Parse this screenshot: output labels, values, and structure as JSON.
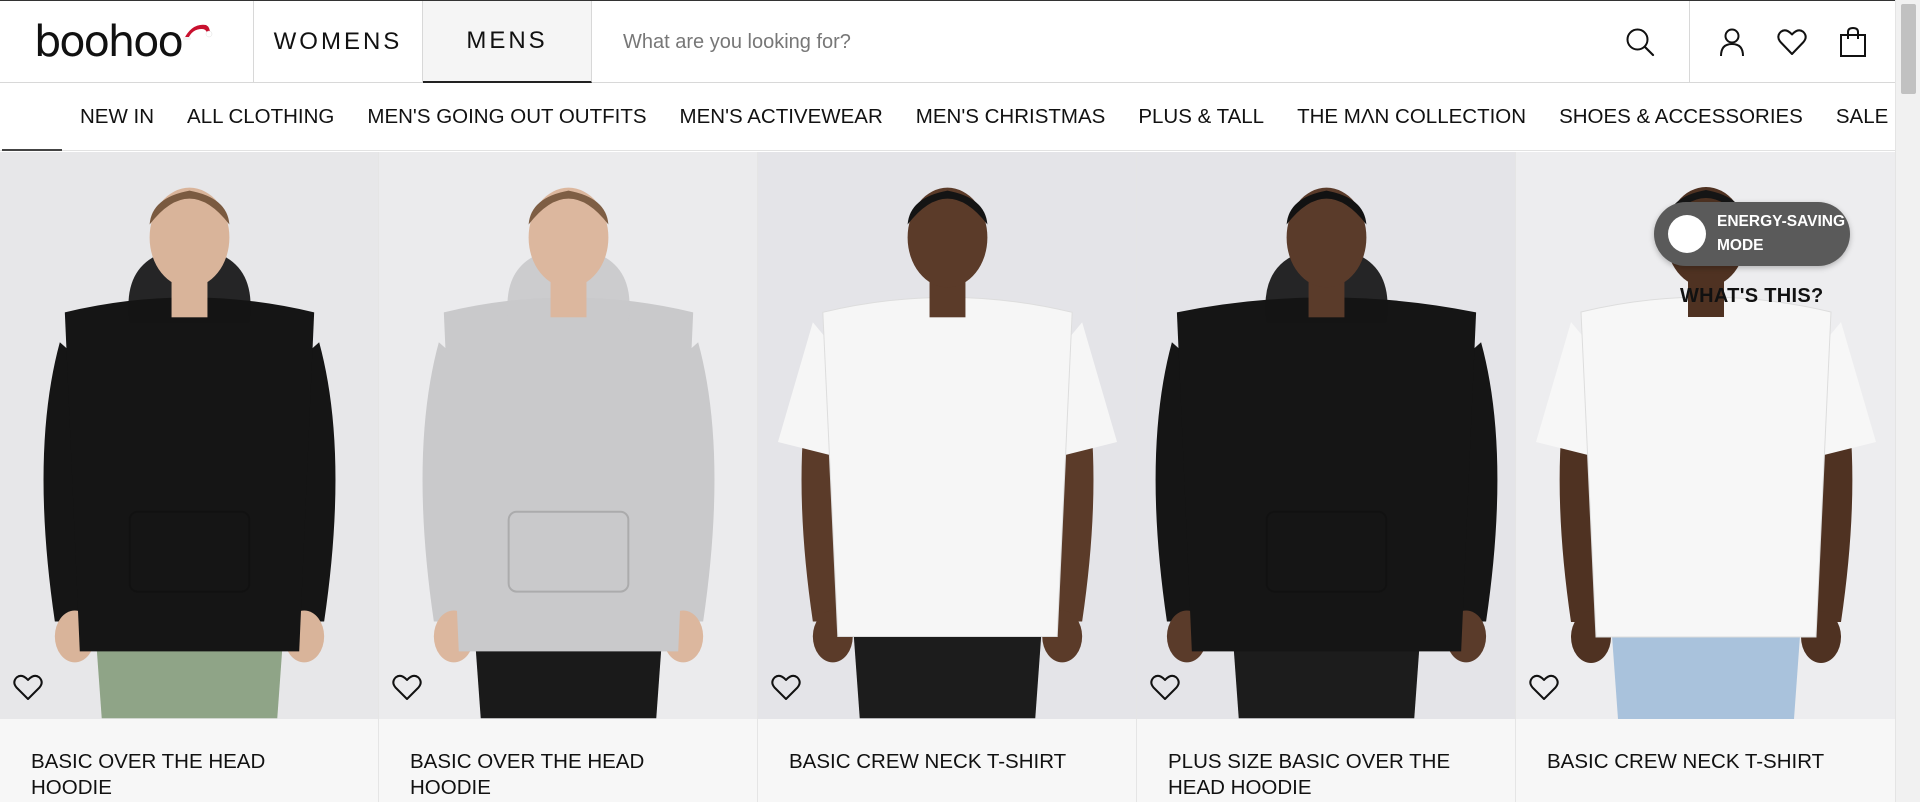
{
  "header": {
    "logo_text": "boohoo",
    "gender_tabs": [
      {
        "label": "WOMENS",
        "active": false
      },
      {
        "label": "MENS",
        "active": true
      }
    ],
    "search": {
      "placeholder": "What are you looking for?",
      "icon": "search-icon"
    },
    "icons": [
      "account-icon",
      "wishlist-icon",
      "bag-icon"
    ]
  },
  "nav": {
    "items": [
      {
        "label": "NEW IN"
      },
      {
        "label": "ALL CLOTHING"
      },
      {
        "label": "MEN'S GOING OUT OUTFITS"
      },
      {
        "label": "MEN'S ACTIVEWEAR"
      },
      {
        "label": "MEN'S CHRISTMAS"
      },
      {
        "label": "PLUS & TALL"
      },
      {
        "label": "THE MΛN COLLECTION"
      },
      {
        "label": "SHOES & ACCESSORIES"
      },
      {
        "label": "SALE"
      }
    ]
  },
  "products": [
    {
      "title": "BASIC OVER THE HEAD HOODIE",
      "top_color": "#151515",
      "bottom_color": "#8fa487",
      "skin": "#d9b49a",
      "hair": "#7a5a40",
      "bg": "#e7e7e9"
    },
    {
      "title": "BASIC OVER THE HEAD HOODIE",
      "top_color": "#c9c9cb",
      "bottom_color": "#1a1a1a",
      "skin": "#dcb79e",
      "hair": "#7e5e44",
      "bg": "#ebebed"
    },
    {
      "title": "BASIC CREW NECK T-SHIRT",
      "top_color": "#f6f6f6",
      "bottom_color": "#1c1c1c",
      "skin": "#5b3b29",
      "hair": "#141414",
      "bg": "#e4e4e8"
    },
    {
      "title": "PLUS SIZE BASIC OVER THE HEAD HOODIE",
      "top_color": "#151515",
      "bottom_color": "#1c1c1c",
      "skin": "#5a3b2a",
      "hair": "#121212",
      "bg": "#e4e4e8"
    },
    {
      "title": "BASIC CREW NECK T-SHIRT",
      "top_color": "#f7f7f7",
      "bottom_color": "#a9c2dc",
      "skin": "#4f3222",
      "hair": "#151515",
      "bg": "#ededef"
    }
  ],
  "energy_saving": {
    "label": "ENERGY-SAVING MODE",
    "help": "WHAT'S THIS?"
  }
}
